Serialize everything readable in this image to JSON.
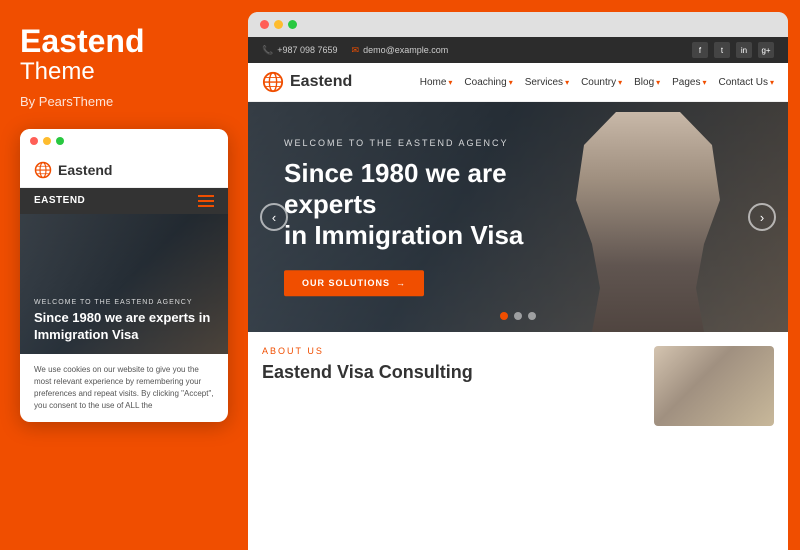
{
  "left_panel": {
    "brand": {
      "title": "Eastend",
      "subtitle": "Theme",
      "by_label": "By PearsTheme"
    },
    "mobile_mockup": {
      "dots": [
        "red",
        "yellow",
        "green"
      ],
      "logo_text": "Eastend",
      "nav_label": "EASTEND",
      "welcome_text": "WELCOME TO THE EASTEND AGENCY",
      "hero_heading": "Since 1980 we are experts in Immigration Visa",
      "body_text": "We use cookies on our website to give you the most relevant experience by remembering your preferences and repeat visits. By clicking \"Accept\", you consent to the use of ALL the"
    }
  },
  "right_panel": {
    "titlebar_dots": [
      "red",
      "yellow",
      "green"
    ],
    "info_bar": {
      "phone": "+987 098 7659",
      "email": "demo@example.com",
      "social": [
        "f",
        "t",
        "in",
        "g"
      ]
    },
    "nav": {
      "logo_text": "Eastend",
      "links": [
        {
          "label": "Home",
          "has_arrow": true
        },
        {
          "label": "Coaching",
          "has_arrow": true
        },
        {
          "label": "Services",
          "has_arrow": true
        },
        {
          "label": "Country",
          "has_arrow": true
        },
        {
          "label": "Blog",
          "has_arrow": true
        },
        {
          "label": "Pages",
          "has_arrow": true
        },
        {
          "label": "Contact Us",
          "has_arrow": true
        }
      ]
    },
    "hero": {
      "welcome_text": "WELCOME TO THE EASTEND AGENCY",
      "heading_line1": "Since 1980 we are experts",
      "heading_line2": "in Immigration Visa",
      "btn_label": "OUR SOLUTIONS",
      "btn_arrow": "→",
      "prev_btn": "‹",
      "next_btn": "›",
      "dots": [
        {
          "active": true
        },
        {
          "active": false
        },
        {
          "active": false
        }
      ]
    },
    "about": {
      "label": "ABOUT US",
      "heading": "Eastend Visa Consulting"
    }
  }
}
